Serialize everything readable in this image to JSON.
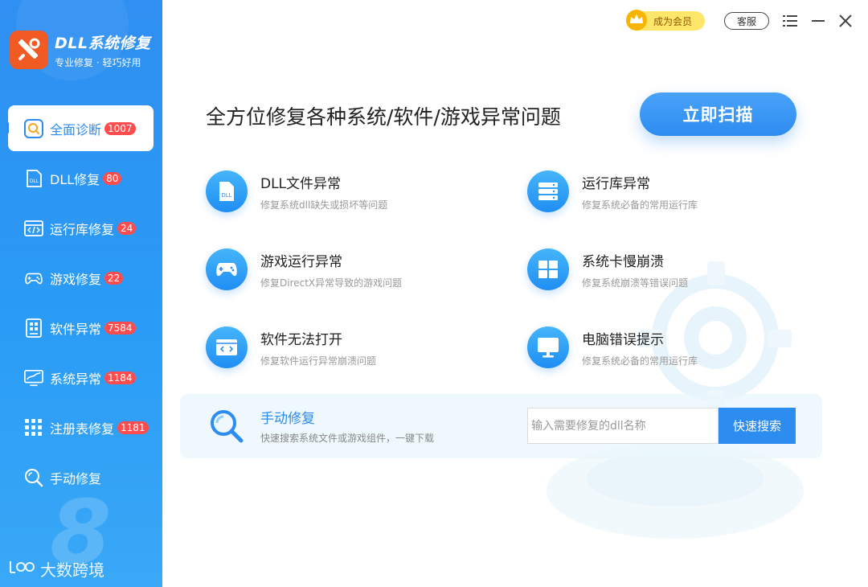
{
  "brand": {
    "title": "DLL系统修复",
    "subtitle": "专业修复 · 轻巧好用"
  },
  "titlebar": {
    "vip_label": "成为会员",
    "service_label": "客服"
  },
  "sidebar": {
    "items": [
      {
        "label": "全面诊断",
        "badge": "1007",
        "icon": "search-icon",
        "active": true
      },
      {
        "label": "DLL修复",
        "badge": "80",
        "icon": "dll-file-icon"
      },
      {
        "label": "运行库修复",
        "badge": "24",
        "icon": "code-window-icon"
      },
      {
        "label": "游戏修复",
        "badge": "22",
        "icon": "gamepad-icon"
      },
      {
        "label": "软件异常",
        "badge": "7584",
        "icon": "software-icon"
      },
      {
        "label": "系统异常",
        "badge": "1184",
        "icon": "monitor-chart-icon"
      },
      {
        "label": "注册表修复",
        "badge": "1181",
        "icon": "grid-icon"
      },
      {
        "label": "手动修复",
        "badge": "",
        "icon": "magnifier-icon"
      }
    ],
    "bignum": "8",
    "watermark": "大数跨境"
  },
  "main": {
    "headline": "全方位修复各种系统/软件/游戏异常问题",
    "scan_label": "立即扫描",
    "features": [
      {
        "title": "DLL文件异常",
        "subtitle": "修复系统dll缺失或损坏等问题",
        "icon": "dll-file-icon"
      },
      {
        "title": "运行库异常",
        "subtitle": "修复系统必备的常用运行库",
        "icon": "server-icon"
      },
      {
        "title": "游戏运行异常",
        "subtitle": "修复DirectX异常导致的游戏问题",
        "icon": "gamepad-icon"
      },
      {
        "title": "系统卡慢崩溃",
        "subtitle": "修复系统崩溃等错误问题",
        "icon": "windows-icon"
      },
      {
        "title": "软件无法打开",
        "subtitle": "修复软件运行异常崩溃问题",
        "icon": "code-window-icon"
      },
      {
        "title": "电脑错误提示",
        "subtitle": "修复系统必备的常用运行库",
        "icon": "monitor-icon"
      }
    ],
    "manual": {
      "title": "手动修复",
      "subtitle": "快速搜索系统文件或游戏组件，一键下载",
      "placeholder": "输入需要修复的dll名称",
      "value": "",
      "button": "快速搜索"
    }
  },
  "colors": {
    "accent": "#2d8cf0",
    "badge": "#ff4d4f",
    "logo": "#f25a24",
    "vip": "#fde66a"
  }
}
